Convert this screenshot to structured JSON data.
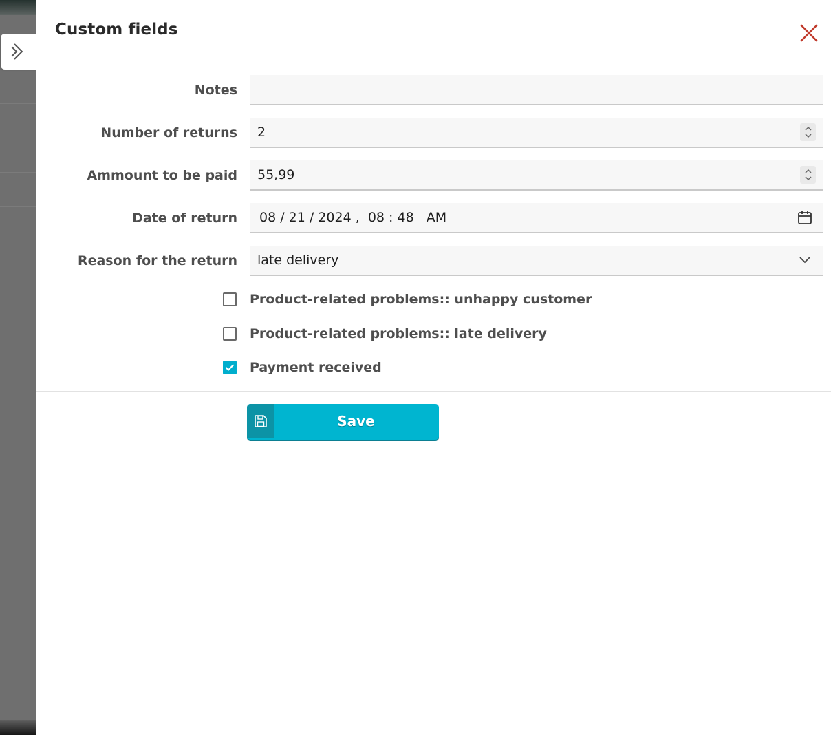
{
  "panel": {
    "title": "Custom fields"
  },
  "fields": {
    "notes": {
      "label": "Notes",
      "value": ""
    },
    "number_of_returns": {
      "label": "Number of returns",
      "value": "2"
    },
    "amount_to_be_paid": {
      "label": "Ammount to be paid",
      "value": "55,99"
    },
    "date_of_return": {
      "label": "Date of return",
      "value": "08 / 21 / 2024 ,  08 : 48   AM"
    },
    "reason_for_return": {
      "label": "Reason for the return",
      "value": "late delivery"
    }
  },
  "checkboxes": [
    {
      "label": "Product-related problems:: unhappy customer",
      "checked": false
    },
    {
      "label": "Product-related problems:: late delivery",
      "checked": false
    },
    {
      "label": "Payment received",
      "checked": true
    }
  ],
  "actions": {
    "save_label": "Save"
  },
  "icons": {
    "collapse": "chevron-right-icon",
    "close": "close-icon",
    "spinner": "spinner-arrows-icon",
    "calendar": "calendar-icon",
    "dropdown": "chevron-down-icon",
    "checkmark": "checkmark-icon",
    "save": "floppy-disk-icon"
  },
  "colors": {
    "accent": "#00b5d0",
    "accent_dark": "#0c93a6",
    "close": "#c0392b",
    "checkbox_checked": "#00aecd"
  }
}
